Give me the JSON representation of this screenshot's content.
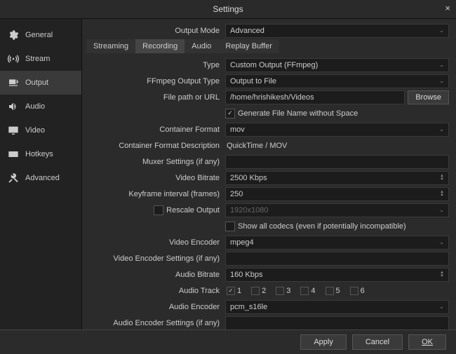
{
  "window": {
    "title": "Settings",
    "close_label": "×"
  },
  "sidebar": {
    "items": [
      {
        "label": "General"
      },
      {
        "label": "Stream"
      },
      {
        "label": "Output"
      },
      {
        "label": "Audio"
      },
      {
        "label": "Video"
      },
      {
        "label": "Hotkeys"
      },
      {
        "label": "Advanced"
      }
    ]
  },
  "output_mode": {
    "label": "Output Mode",
    "value": "Advanced"
  },
  "tabs": {
    "streaming": "Streaming",
    "recording": "Recording",
    "audio": "Audio",
    "replay": "Replay Buffer"
  },
  "form": {
    "type": {
      "label": "Type",
      "value": "Custom Output (FFmpeg)"
    },
    "ffmpeg_output_type": {
      "label": "FFmpeg Output Type",
      "value": "Output to File"
    },
    "file_path": {
      "label": "File path or URL",
      "value": "/home/hrishikesh/Videos",
      "browse": "Browse"
    },
    "gen_filename": {
      "label": "Generate File Name without Space",
      "checked": true
    },
    "container_format": {
      "label": "Container Format",
      "value": "mov"
    },
    "container_desc": {
      "label": "Container Format Description",
      "value": "QuickTime / MOV"
    },
    "muxer_settings": {
      "label": "Muxer Settings (if any)",
      "value": ""
    },
    "video_bitrate": {
      "label": "Video Bitrate",
      "value": "2500 Kbps"
    },
    "keyframe_interval": {
      "label": "Keyframe interval (frames)",
      "value": "250"
    },
    "rescale_output": {
      "label": "Rescale Output",
      "placeholder": "1920x1080",
      "checked": false
    },
    "show_all_codecs": {
      "label": "Show all codecs (even if potentially incompatible)",
      "checked": false
    },
    "video_encoder": {
      "label": "Video Encoder",
      "value": "mpeg4"
    },
    "video_encoder_settings": {
      "label": "Video Encoder Settings (if any)",
      "value": ""
    },
    "audio_bitrate": {
      "label": "Audio Bitrate",
      "value": "160 Kbps"
    },
    "audio_track": {
      "label": "Audio Track",
      "tracks": [
        "1",
        "2",
        "3",
        "4",
        "5",
        "6"
      ],
      "selected": 1
    },
    "audio_encoder": {
      "label": "Audio Encoder",
      "value": "pcm_s16le"
    },
    "audio_encoder_settings": {
      "label": "Audio Encoder Settings (if any)",
      "value": ""
    }
  },
  "footer": {
    "apply": "Apply",
    "cancel": "Cancel",
    "ok": "OK"
  }
}
